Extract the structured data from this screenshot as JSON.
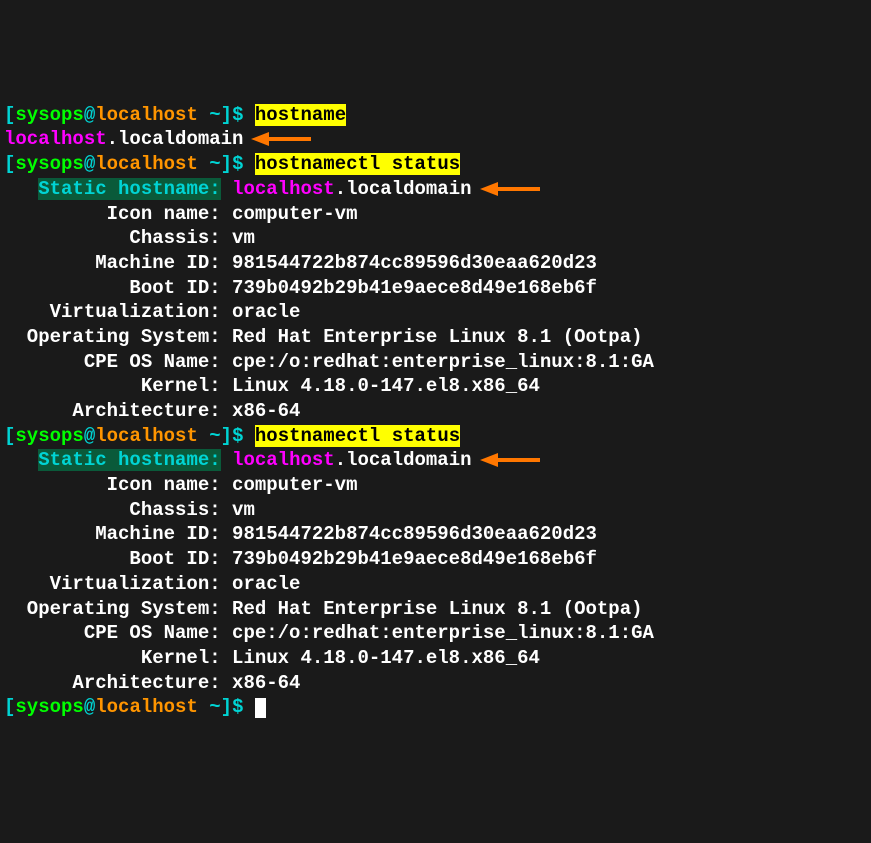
{
  "prompt": {
    "user": "sysops",
    "host": "localhost",
    "path": "~"
  },
  "commands": {
    "cmd1": "hostname",
    "cmd2": "hostnamectl status"
  },
  "output": {
    "hostname_short": "localhost",
    "hostname_domain": ".localdomain",
    "static_label": "Static hostname:",
    "static_host": "localhost",
    "static_domain": ".localdomain",
    "icon_name_label": "         Icon name: ",
    "icon_name": "computer-vm",
    "chassis_label": "           Chassis: ",
    "chassis": "vm",
    "machine_id_label": "        Machine ID: ",
    "machine_id": "981544722b874cc89596d30eaa620d23",
    "boot_id_label": "           Boot ID: ",
    "boot_id": "739b0492b29b41e9aece8d49e168eb6f",
    "virt_label": "    Virtualization: ",
    "virt": "oracle",
    "os_label": "  Operating System: ",
    "os": "Red Hat Enterprise Linux 8.1 (Ootpa)",
    "cpe_label": "       CPE OS Name: ",
    "cpe": "cpe:/o:redhat:enterprise_linux:8.1:GA",
    "kernel_label": "            Kernel: ",
    "kernel": "Linux 4.18.0-147.el8.x86_64",
    "arch_label": "      Architecture: ",
    "arch": "x86-64"
  }
}
